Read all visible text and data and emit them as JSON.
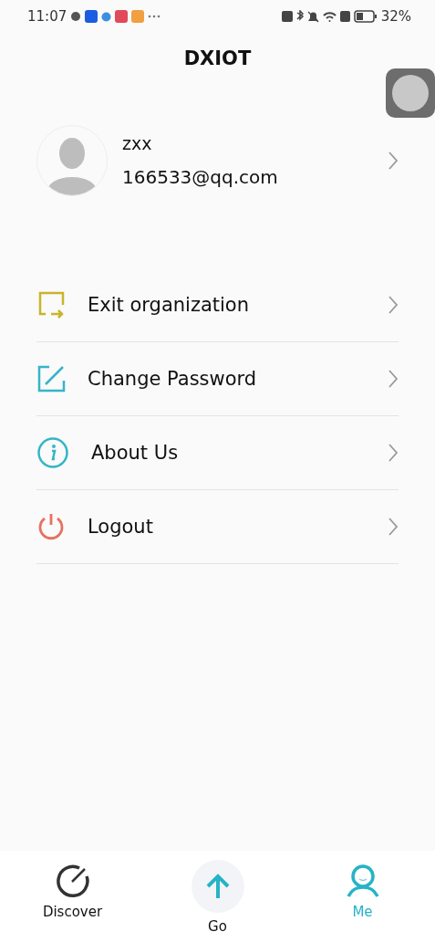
{
  "status_bar": {
    "time": "11:07",
    "battery": "32%"
  },
  "title": "DXIOT",
  "profile": {
    "name": "zxx",
    "email": "166533@qq.com"
  },
  "menu": [
    {
      "kind": "exit",
      "label": "Exit organization"
    },
    {
      "kind": "edit",
      "label": "Change Password"
    },
    {
      "kind": "info",
      "label": "About Us"
    },
    {
      "kind": "power",
      "label": "Logout"
    }
  ],
  "tabs": [
    {
      "kind": "discover",
      "label": "Discover",
      "selected": false
    },
    {
      "kind": "go",
      "label": "Go",
      "selected": false
    },
    {
      "kind": "me",
      "label": "Me",
      "selected": true
    }
  ]
}
